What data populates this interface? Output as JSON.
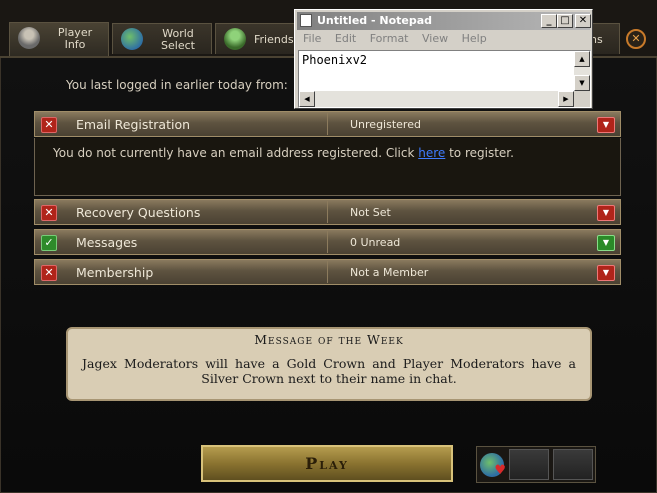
{
  "tabs": [
    {
      "line1": "Player",
      "line2": "Info",
      "icon": "player-icon"
    },
    {
      "line1": "World",
      "line2": "Select",
      "icon": "globe-icon"
    },
    {
      "label": "Friends",
      "icon": "friends-icon"
    },
    {
      "label": "ns",
      "icon": ""
    }
  ],
  "last_login": "You last logged in earlier today from:",
  "rows": [
    {
      "name": "Email Registration",
      "value": "Unregistered",
      "status": "x"
    },
    {
      "name": "Recovery Questions",
      "value": "Not Set",
      "status": "x"
    },
    {
      "name": "Messages",
      "value": "0 Unread",
      "status": "ok"
    },
    {
      "name": "Membership",
      "value": "Not a Member",
      "status": "x"
    }
  ],
  "email_detail": {
    "before": "You do not currently have an email address registered. Click ",
    "link": "here",
    "after": " to register."
  },
  "motw": {
    "title": "Message of the Week",
    "body": "Jagex Moderators will have a Gold Crown and Player Moderators have a Silver Crown next to their name in chat."
  },
  "play_label": "Play",
  "notepad": {
    "title": "Untitled - Notepad",
    "menu": [
      "File",
      "Edit",
      "Format",
      "View",
      "Help"
    ],
    "content": "Phoenixv2"
  },
  "colors": {
    "accent_gold": "#b59c4e",
    "error_red": "#b0241a",
    "ok_green": "#2e8a2a",
    "link_blue": "#3f7cff"
  }
}
